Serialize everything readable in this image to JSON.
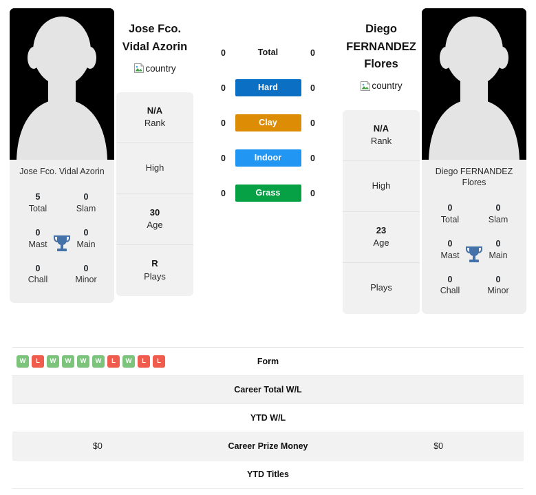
{
  "players": {
    "left": {
      "name_lines": [
        "Jose Fco.",
        "Vidal Azorin"
      ],
      "caption": "Jose Fco. Vidal Azorin",
      "country_alt": "country",
      "info": [
        {
          "value": "N/A",
          "label": "Rank"
        },
        {
          "value": "",
          "label": "High"
        },
        {
          "value": "30",
          "label": "Age"
        },
        {
          "value": "R",
          "label": "Plays"
        }
      ],
      "titles": [
        {
          "num": "5",
          "label": "Total"
        },
        {
          "num": "0",
          "label": "Slam"
        },
        {
          "num": "0",
          "label": "Mast"
        },
        {
          "num": "0",
          "label": "Main"
        },
        {
          "num": "0",
          "label": "Chall"
        },
        {
          "num": "0",
          "label": "Minor"
        }
      ]
    },
    "right": {
      "name_lines": [
        "Diego",
        "FERNANDEZ",
        "Flores"
      ],
      "caption_lines": [
        "Diego FERNANDEZ",
        "Flores"
      ],
      "country_alt": "country",
      "info": [
        {
          "value": "N/A",
          "label": "Rank"
        },
        {
          "value": "",
          "label": "High"
        },
        {
          "value": "23",
          "label": "Age"
        },
        {
          "value": "",
          "label": "Plays"
        }
      ],
      "titles": [
        {
          "num": "0",
          "label": "Total"
        },
        {
          "num": "0",
          "label": "Slam"
        },
        {
          "num": "0",
          "label": "Mast"
        },
        {
          "num": "0",
          "label": "Main"
        },
        {
          "num": "0",
          "label": "Chall"
        },
        {
          "num": "0",
          "label": "Minor"
        }
      ]
    }
  },
  "surfaces": [
    {
      "label": "Total",
      "left": "0",
      "right": "0",
      "color": "transparent"
    },
    {
      "label": "Hard",
      "left": "0",
      "right": "0",
      "color": "#0b6fc4"
    },
    {
      "label": "Clay",
      "left": "0",
      "right": "0",
      "color": "#dd8c06"
    },
    {
      "label": "Indoor",
      "left": "0",
      "right": "0",
      "color": "#2196f3"
    },
    {
      "label": "Grass",
      "left": "0",
      "right": "0",
      "color": "#06a045"
    }
  ],
  "form": {
    "left_results": [
      "W",
      "L",
      "W",
      "W",
      "W",
      "W",
      "L",
      "W",
      "L",
      "L"
    ],
    "right_results": [],
    "win_color": "#7cc47c",
    "loss_color": "#ef5b4c"
  },
  "stat_rows": [
    {
      "label": "Form",
      "left": "",
      "right": ""
    },
    {
      "label": "Career Total W/L",
      "left": "",
      "right": ""
    },
    {
      "label": "YTD W/L",
      "left": "",
      "right": ""
    },
    {
      "label": "Career Prize Money",
      "left": "$0",
      "right": "$0"
    },
    {
      "label": "YTD Titles",
      "left": "",
      "right": ""
    }
  ],
  "colors": {
    "trophy": "#4371a8",
    "card_bg": "#efefef",
    "row_alt": "#f2f2f2"
  }
}
